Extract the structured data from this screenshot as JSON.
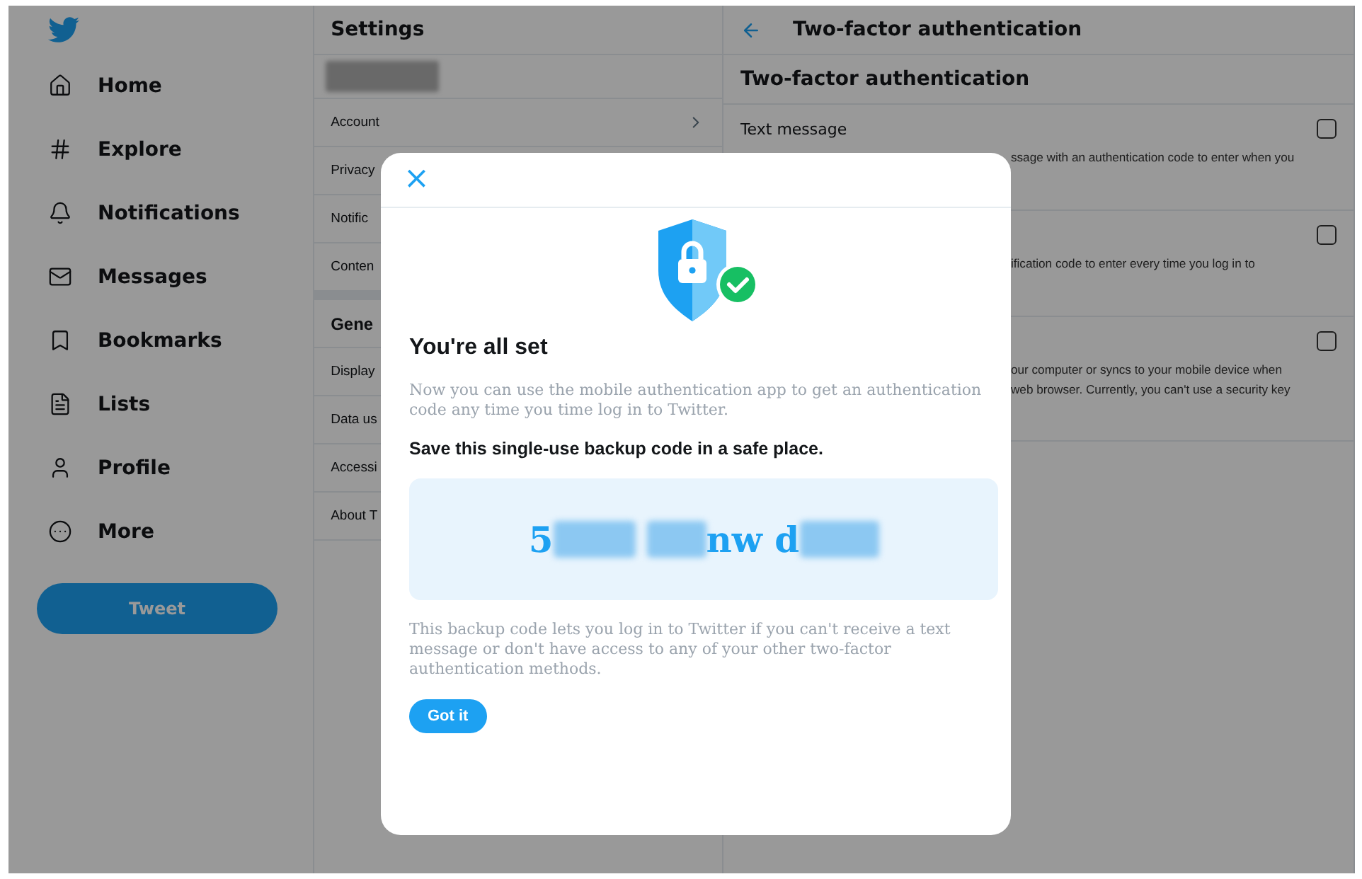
{
  "sidebar": {
    "items": [
      {
        "label": "Home",
        "selected": false
      },
      {
        "label": "Explore",
        "selected": false
      },
      {
        "label": "Notifications",
        "selected": false
      },
      {
        "label": "Messages",
        "selected": false
      },
      {
        "label": "Bookmarks",
        "selected": false
      },
      {
        "label": "Lists",
        "selected": false
      },
      {
        "label": "Profile",
        "selected": false
      },
      {
        "label": "More",
        "selected": false
      }
    ],
    "tweet_button": "Tweet"
  },
  "settings": {
    "title": "Settings",
    "account": {
      "kind": "redacted"
    },
    "items": [
      {
        "label": "Account",
        "chevron": true
      },
      {
        "label": "Privacy"
      },
      {
        "label": "Notific"
      },
      {
        "label": "Conten"
      }
    ],
    "general": {
      "title": "Gene",
      "items": [
        {
          "label": "Display"
        },
        {
          "label": "Data us"
        },
        {
          "label": "Accessi"
        },
        {
          "label": "About T"
        }
      ]
    }
  },
  "two_factor": {
    "title": "Two-factor authentication",
    "section_title": "Two-factor authentication",
    "options": [
      {
        "label": "Text message",
        "checked": false,
        "description": [
          "ssage with an authentication code to enter when you"
        ]
      },
      {
        "checked": false,
        "description": [
          "ification code to enter every time you log in to"
        ]
      },
      {
        "checked": false,
        "description": [
          "our computer or syncs to your mobile device when",
          "web browser. Currently, you can't use a security key"
        ]
      }
    ]
  },
  "modal": {
    "close": "×",
    "title": "You're all set",
    "intro": "Now you can use the mobile authentication app to get an authentication code any time you time log in to Twitter.",
    "save_note": "Save this single-use backup code in a safe place.",
    "backup_code": [
      {
        "kind": "text",
        "text": "5"
      },
      {
        "kind": "redacted"
      },
      {
        "kind": "space"
      },
      {
        "kind": "redacted"
      },
      {
        "kind": "text",
        "text": "nw d"
      },
      {
        "kind": "redacted"
      }
    ],
    "explanation": "This backup code lets you log in to Twitter if you can't receive a text message or don't have access to any of your other two-factor authentication methods.",
    "button": "Got it"
  }
}
